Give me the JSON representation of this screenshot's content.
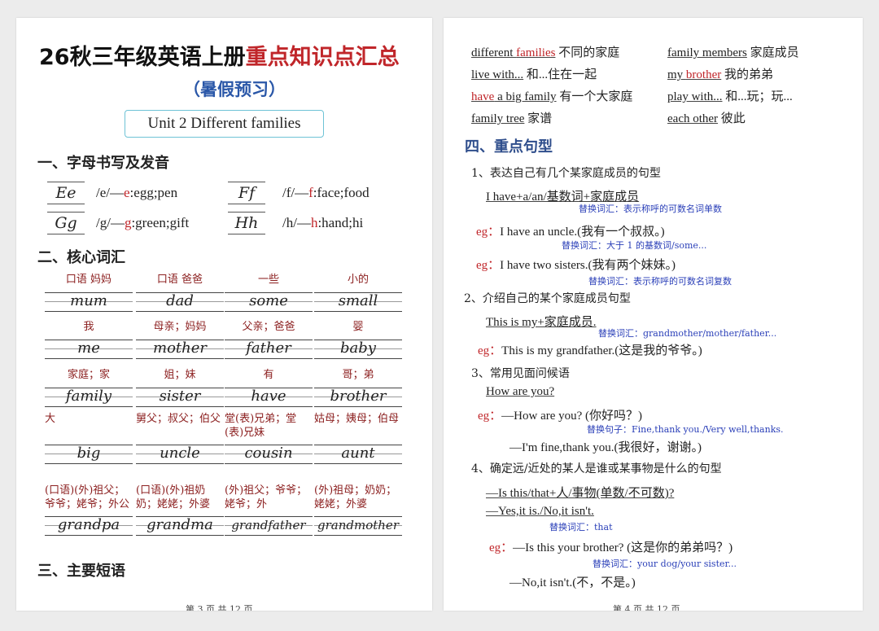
{
  "left": {
    "title_black": "26秋三年级英语上册",
    "title_red": "重点知识点汇总",
    "subtitle": "（暑假预习）",
    "unit": "Unit 2 Different families",
    "sec1": "一、字母书写及发音",
    "letters": [
      {
        "glyph": "Ee",
        "pre": "/e/—",
        "red": "e",
        "post": ":egg;pen"
      },
      {
        "glyph": "Ff",
        "pre": "/f/—",
        "red": "f",
        "post": ":face;food"
      },
      {
        "glyph": "Gg",
        "pre": "/g/—",
        "red": "g",
        "post": ":green;gift"
      },
      {
        "glyph": "Hh",
        "pre": "/h/—",
        "red": "h",
        "post": ":hand;hi"
      }
    ],
    "sec2": "二、核心词汇",
    "vocab": [
      {
        "cn": "口语 妈妈",
        "en": "mum"
      },
      {
        "cn": "口语 爸爸",
        "en": "dad"
      },
      {
        "cn": "一些",
        "en": "some"
      },
      {
        "cn": "小的",
        "en": "small"
      },
      {
        "cn": "我",
        "en": "me"
      },
      {
        "cn": "母亲；妈妈",
        "en": "mother"
      },
      {
        "cn": "父亲；爸爸",
        "en": "father"
      },
      {
        "cn": "婴",
        "en": "baby"
      },
      {
        "cn": "家庭；家",
        "en": "family"
      },
      {
        "cn": "姐；妹",
        "en": "sister"
      },
      {
        "cn": "有",
        "en": "have"
      },
      {
        "cn": "哥；弟",
        "en": "brother"
      },
      {
        "cn": "大",
        "en": "big"
      },
      {
        "cn": "舅父；叔父；伯父",
        "en": "uncle"
      },
      {
        "cn": "堂(表)兄弟；堂(表)兄妹",
        "en": "cousin"
      },
      {
        "cn": "姑母；姨母；伯母",
        "en": "aunt"
      },
      {
        "cn": "(口语)(外)祖父；爷爷；姥爷；外公",
        "en": "grandpa"
      },
      {
        "cn": "(口语)(外)祖奶奶；姥姥；外婆",
        "en": "grandma"
      },
      {
        "cn": "(外)祖父；爷爷；姥爷；外",
        "en": "grandfather"
      },
      {
        "cn": "(外)祖母；奶奶；姥姥；外婆",
        "en": "grandmother"
      }
    ],
    "sec3": "三、主要短语",
    "footer": "第 3 页 共 12 页"
  },
  "right": {
    "phrases": [
      {
        "pre": "different ",
        "red": "families",
        "post": "",
        "cn": "不同的家庭"
      },
      {
        "pre": "family members",
        "red": "",
        "post": "",
        "cn": "家庭成员"
      },
      {
        "pre": "live with...",
        "red": "",
        "post": "",
        "cn": "和...住在一起"
      },
      {
        "pre": "my ",
        "red": "brother",
        "post": "",
        "cn": "我的弟弟"
      },
      {
        "pre": "",
        "red": "have",
        "post": " a big family",
        "cn": "有一个大家庭"
      },
      {
        "pre": "play with...",
        "red": "",
        "post": "",
        "cn": "和...玩；玩..."
      },
      {
        "pre": "family tree",
        "red": "",
        "post": "",
        "cn": "家谱"
      },
      {
        "pre": "each other",
        "red": "",
        "post": "",
        "cn": "彼此"
      }
    ],
    "sec4": "四、重点句型",
    "s1_title": "1、表达自己有几个某家庭成员的句型",
    "s1_pattern": "I have+a/an/基数词+家庭成员",
    "s1_hint1": "替换词汇：表示称呼的可数名词单数",
    "s1_eg1": "I have an uncle.(我有一个叔叔。)",
    "s1_hint2": "替换词汇：大于 1 的基数词/some...",
    "s1_eg2": "I have two sisters.(我有两个妹妹。)",
    "s1_hint3": "替换词汇：表示称呼的可数名词复数",
    "s2_title": "2、介绍自己的某个家庭成员句型",
    "s2_pattern": "This is my+家庭成员.",
    "s2_hint": "替换词汇：grandmother/mother/father...",
    "s2_eg": "This is my grandfather.(这是我的爷爷。)",
    "s3_title": "3、常用见面问候语",
    "s3_pattern": "How are you?",
    "s3_eg1": "—How are you? (你好吗？)",
    "s3_hint": "替换句子：Fine,thank you./Very well,thanks.",
    "s3_eg2": "—I'm fine,thank you.(我很好，谢谢。)",
    "s4_title": "4、确定远/近处的某人是谁或某事物是什么的句型",
    "s4_p1": "—Is this/that+人/事物(单数/不可数)?",
    "s4_p2": "—Yes,it is./No,it isn't.",
    "s4_hint1": "替换词汇：that",
    "s4_eg1": "—Is this your brother? (这是你的弟弟吗？)",
    "s4_hint2": "替换词汇：your dog/your sister...",
    "s4_eg2": "—No,it isn't.(不，不是。)",
    "eg_label": "eg：",
    "footer": "第 4 页 共 12 页"
  }
}
